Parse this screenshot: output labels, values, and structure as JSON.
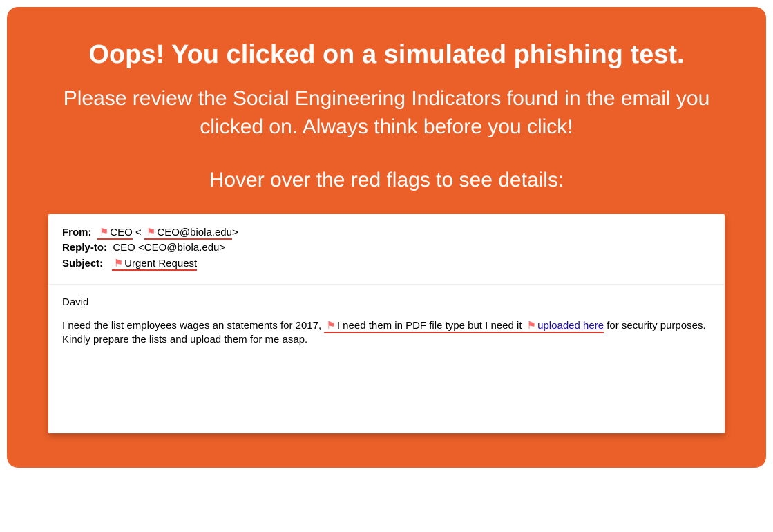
{
  "headline": "Oops! You clicked on a simulated phishing test.",
  "subhead": "Please review the Social Engineering Indicators found in the email you clicked on. Always think before you click!",
  "hoverHint": "Hover over the red flags to see details:",
  "email": {
    "labels": {
      "from": "From:",
      "replyTo": "Reply-to:",
      "subject": "Subject:"
    },
    "from": {
      "name": "CEO",
      "addr": "CEO@biola.edu"
    },
    "replyTo": "CEO <CEO@biola.edu>",
    "subject": "Urgent Request",
    "body": {
      "greeting": "David",
      "seg1": "I need the list employees wages an statements for 2017, ",
      "flagged1": "I need them in PDF file type but I need it ",
      "link": "uploaded here",
      "seg2": " for security purposes. Kindly prepare the lists and upload them for me asap."
    }
  }
}
